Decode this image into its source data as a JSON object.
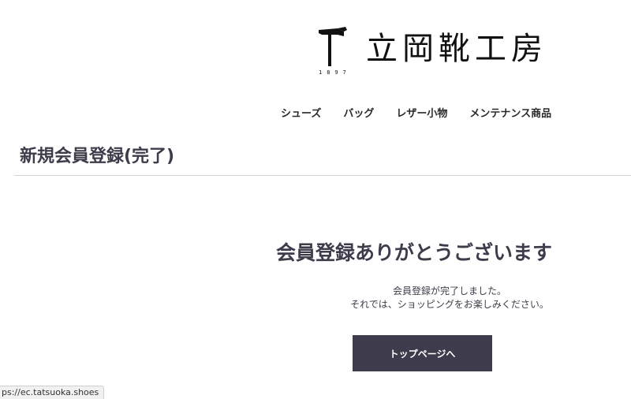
{
  "header": {
    "logo_text": "立岡靴工房",
    "logo_year": "1897"
  },
  "nav": {
    "items": [
      {
        "label": "シューズ"
      },
      {
        "label": "バッグ"
      },
      {
        "label": "レザー小物"
      },
      {
        "label": "メンテナンス商品"
      }
    ]
  },
  "page": {
    "title": "新規会員登録(完了)"
  },
  "complete": {
    "heading": "会員登録ありがとうございます",
    "message_line1": "会員登録が完了しました。",
    "message_line2": "それでは、ショッピングをお楽しみください。",
    "button_label": "トップページへ"
  },
  "status_bar": {
    "url": "ps://ec.tatsuoka.shoes"
  },
  "colors": {
    "text": "#3d3c4a",
    "button_bg": "#3d3b4c",
    "button_text": "#ffffff",
    "rule": "#d6d6d6"
  },
  "icons": {
    "logo_mark": "hammer-icon"
  }
}
